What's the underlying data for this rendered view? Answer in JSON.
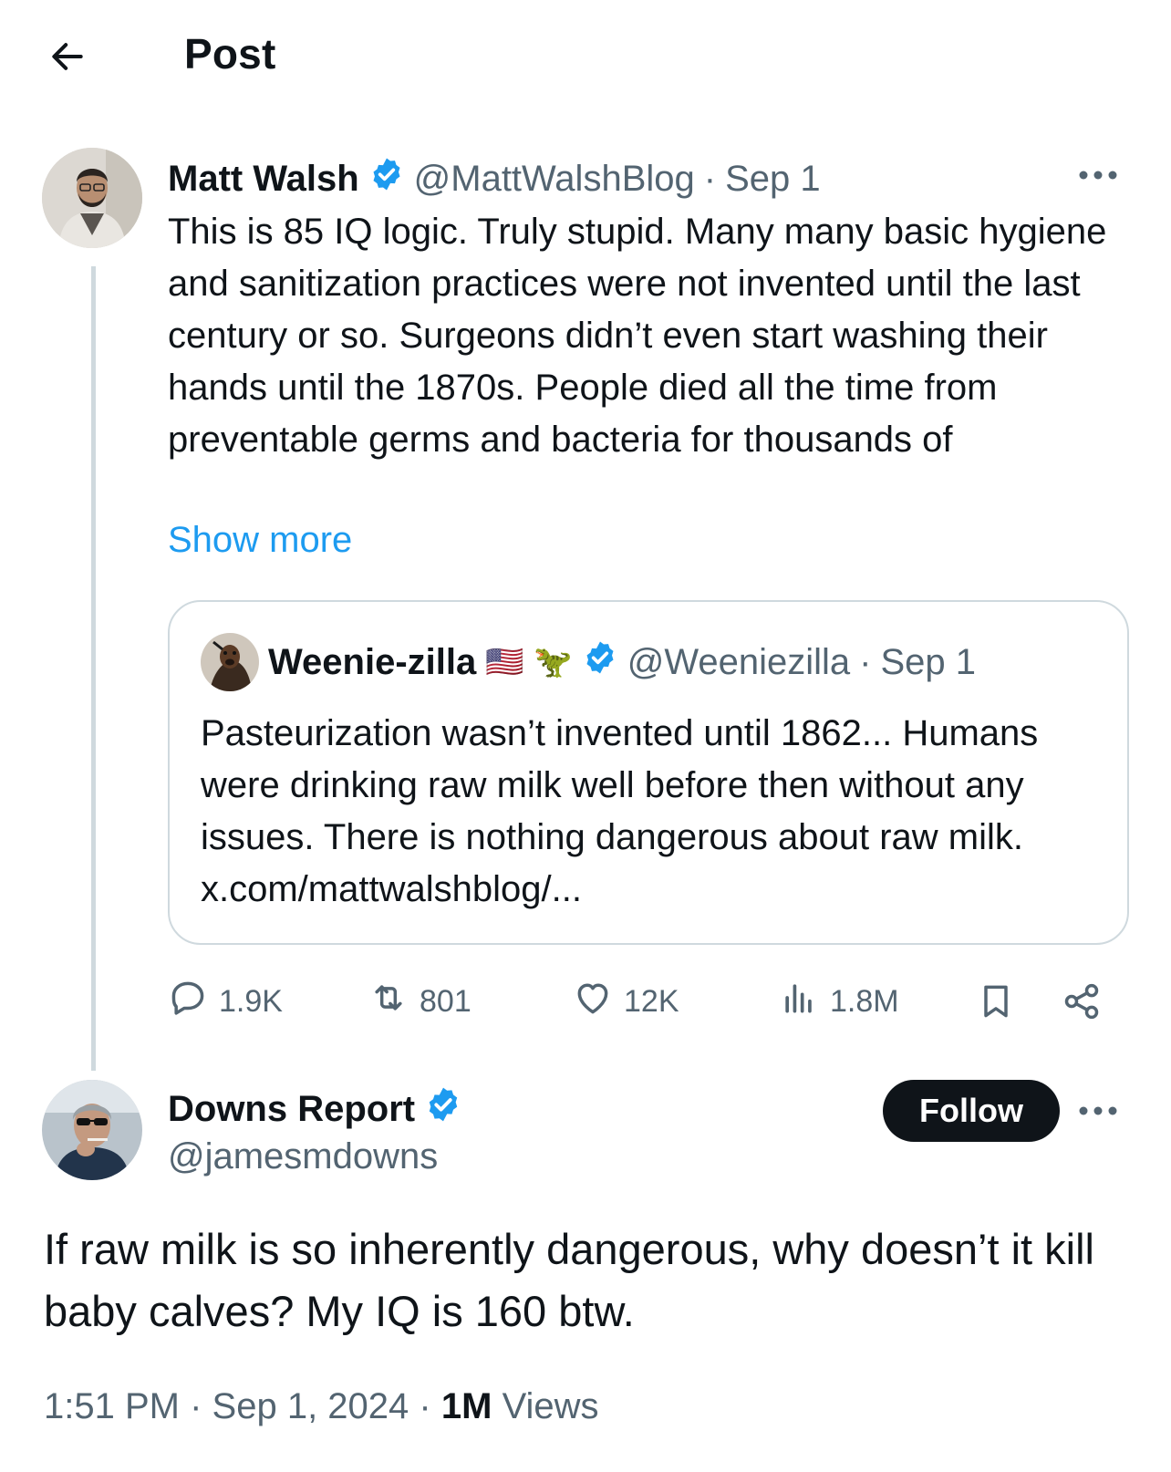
{
  "header": {
    "title": "Post"
  },
  "parent_tweet": {
    "author_name": "Matt Walsh",
    "handle": "@MattWalshBlog",
    "separator": "·",
    "date": "Sep 1",
    "text": "This is 85 IQ logic. Truly stupid. Many many basic hygiene and sanitization practices were not invented until the last century or so. Surgeons didn’t even start washing their hands until the 1870s. People died all the time from preventable germs and bacteria for thousands of",
    "show_more": "Show more",
    "quoted": {
      "author_name": "Weenie-zilla",
      "emojis": "🇺🇸 🦖",
      "handle": "@Weeniezilla",
      "separator": "·",
      "date": "Sep 1",
      "text": "Pasteurization wasn’t invented until 1862... Humans were drinking raw milk well before then without any issues. There is nothing dangerous about raw milk. x.com/mattwalshblog/..."
    },
    "stats": {
      "replies": "1.9K",
      "reposts": "801",
      "likes": "12K",
      "views": "1.8M"
    }
  },
  "reply_tweet": {
    "author_name": "Downs Report",
    "handle": "@jamesmdowns",
    "follow_label": "Follow",
    "text": "If raw milk is so inherently dangerous, why doesn’t it kill baby calves? My IQ is 160 btw.",
    "time": "1:51 PM",
    "separator": "·",
    "date": "Sep 1, 2024",
    "separator2": "·",
    "views_count": "1M",
    "views_label": "Views"
  },
  "icons": {
    "back": "back-arrow-icon",
    "verified": "verified-badge-icon",
    "more": "more-dots-icon",
    "reply": "reply-icon",
    "repost": "repost-icon",
    "like": "heart-icon",
    "views": "views-chart-icon",
    "bookmark": "bookmark-icon",
    "share": "share-icon"
  },
  "colors": {
    "link": "#1d9bf0",
    "muted": "#536471",
    "text": "#0f1419",
    "border": "#cfd9de",
    "verified": "#1d9bf0"
  }
}
